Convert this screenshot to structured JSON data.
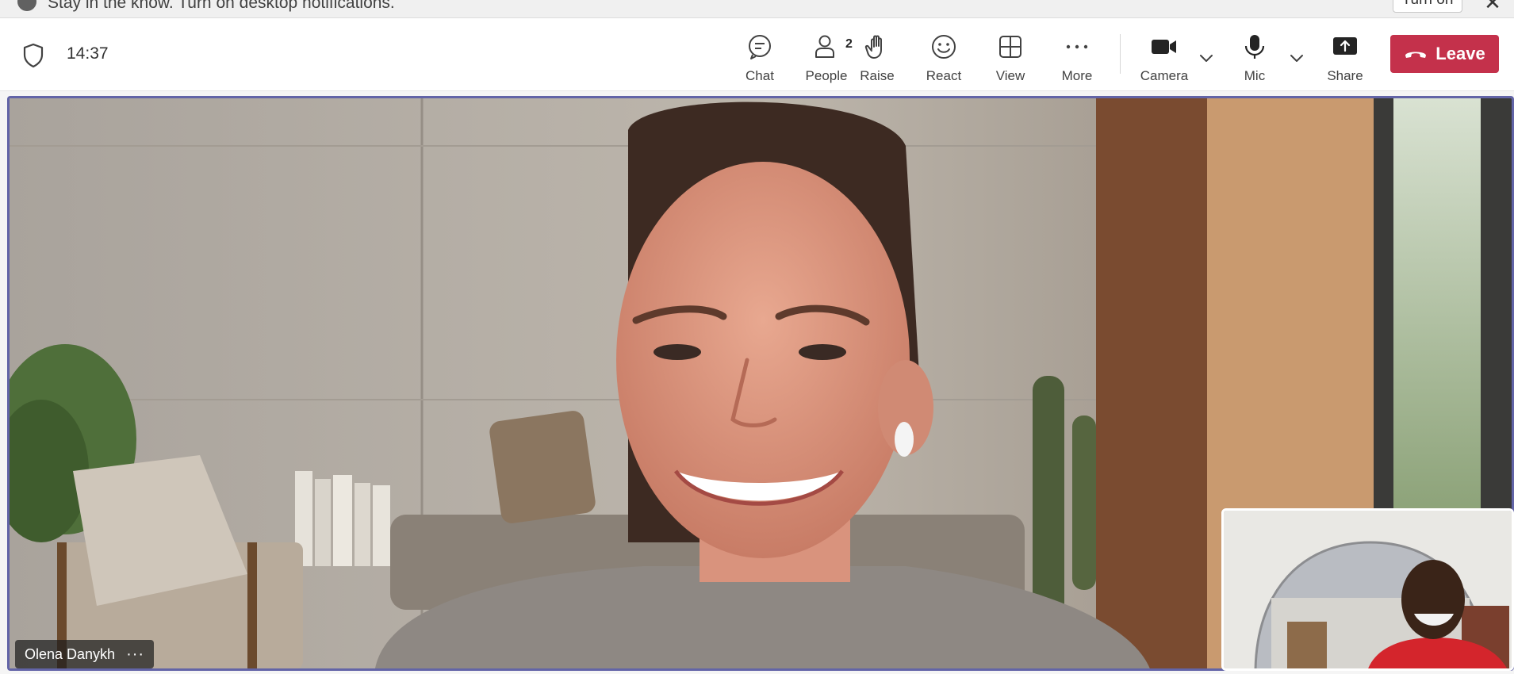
{
  "banner": {
    "text": "Stay in the know. Turn on desktop notifications.",
    "button": "Turn on",
    "close": "✕"
  },
  "toolbar": {
    "timer": "14:37",
    "chat": "Chat",
    "people": "People",
    "people_count": "2",
    "raise": "Raise",
    "react": "React",
    "view": "View",
    "more": "More",
    "camera": "Camera",
    "mic": "Mic",
    "share": "Share",
    "leave": "Leave"
  },
  "video": {
    "participant_name": "Olena Danykh",
    "options": "···"
  },
  "colors": {
    "accent": "#6264a7",
    "leave": "#c4314b"
  }
}
